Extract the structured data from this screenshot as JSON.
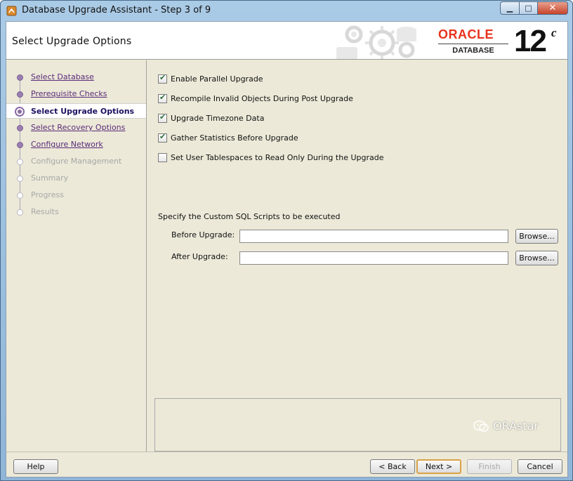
{
  "window": {
    "title": "Database Upgrade Assistant - Step 3 of 9",
    "minimize_glyph": "▁",
    "maximize_glyph": "□",
    "close_glyph": "✕"
  },
  "header": {
    "page_title": "Select Upgrade Options",
    "brand": "ORACLE",
    "brand_sub": "DATABASE",
    "version": "12",
    "version_suffix": "c"
  },
  "nav": {
    "items": [
      {
        "label": "Select Database",
        "state": "done"
      },
      {
        "label": "Prerequisite Checks",
        "state": "done"
      },
      {
        "label": "Select Upgrade Options",
        "state": "current"
      },
      {
        "label": "Select Recovery Options",
        "state": "done"
      },
      {
        "label": "Configure Network",
        "state": "done"
      },
      {
        "label": "Configure Management",
        "state": "pending"
      },
      {
        "label": "Summary",
        "state": "pending"
      },
      {
        "label": "Progress",
        "state": "pending"
      },
      {
        "label": "Results",
        "state": "pending"
      }
    ]
  },
  "options": {
    "items": [
      {
        "label": "Enable Parallel Upgrade",
        "checked": true
      },
      {
        "label": "Recompile Invalid Objects During Post Upgrade",
        "checked": true
      },
      {
        "label": "Upgrade Timezone Data",
        "checked": true
      },
      {
        "label": "Gather Statistics Before Upgrade",
        "checked": true
      },
      {
        "label": "Set User Tablespaces to Read Only During the Upgrade",
        "checked": false
      }
    ]
  },
  "scripts": {
    "section_label": "Specify the Custom SQL Scripts to be executed",
    "before_label": "Before Upgrade:",
    "before_value": "",
    "after_label": "After Upgrade:",
    "after_value": "",
    "browse_label": "Browse..."
  },
  "footer": {
    "help": "Help",
    "back": "< Back",
    "next": "Next >",
    "finish": "Finish",
    "cancel": "Cancel"
  },
  "watermark": "ORAstar",
  "colors": {
    "oracle_red": "#e8321e",
    "nav_done": "#5a2b7a",
    "nav_pending": "#a7a7a7",
    "background": "#ece9d8"
  }
}
